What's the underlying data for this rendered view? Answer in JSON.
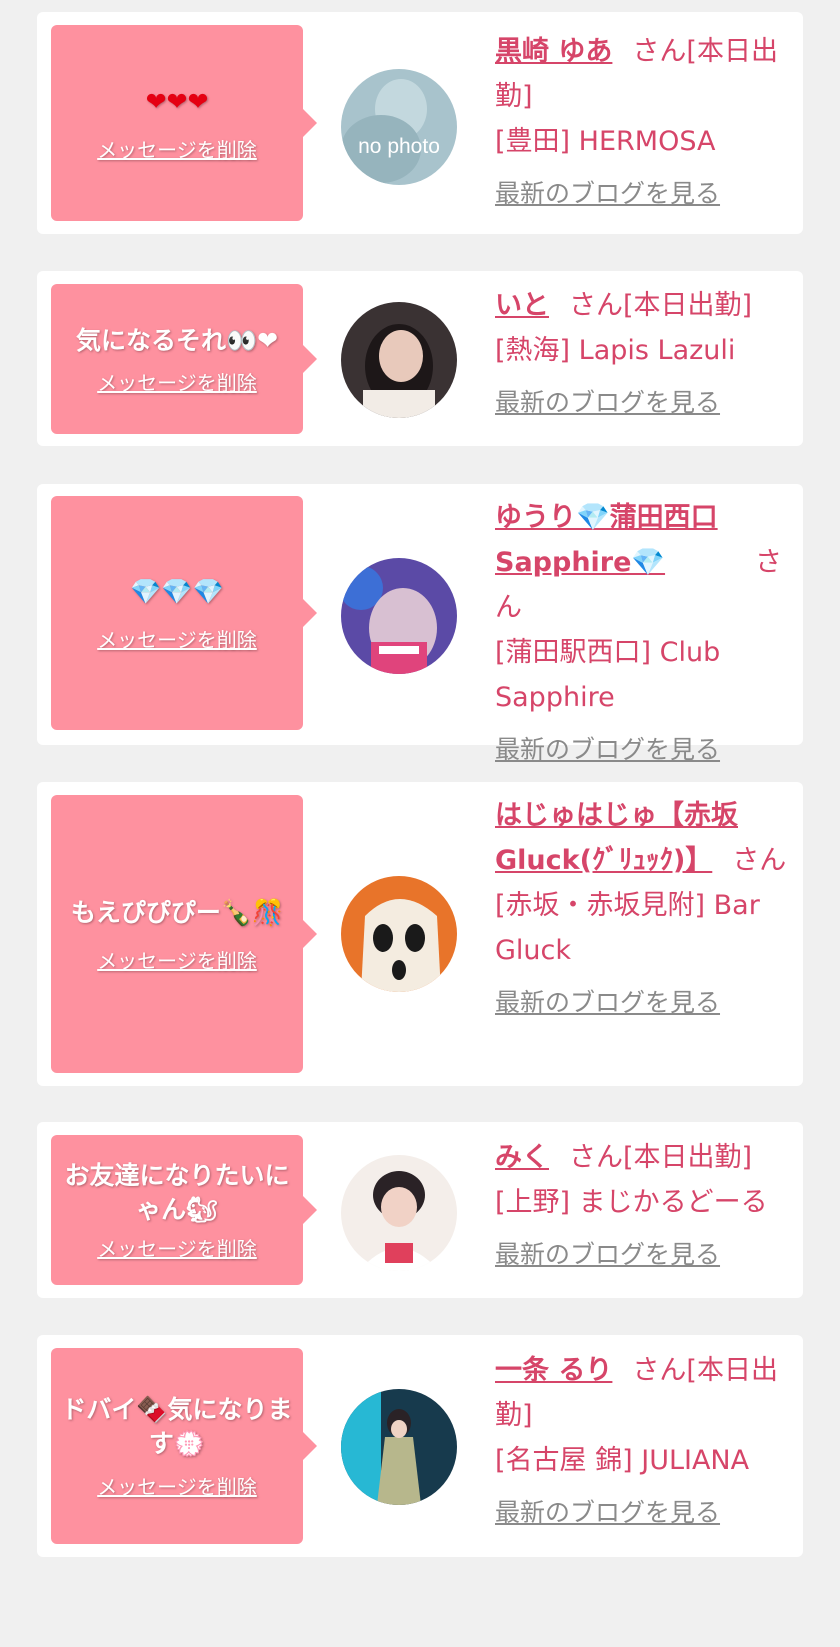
{
  "messages": [
    {
      "message": "❤❤❤",
      "delete_label": "メッセージを削除",
      "name": "黒崎 ゆあ",
      "san": "さん",
      "status": "[本日出勤]",
      "shop": "[豊田] HERMOSA",
      "blog_label": "最新のブログを見る",
      "avatar_text": "no photo"
    },
    {
      "message": "気になるそれ👀❤",
      "delete_label": "メッセージを削除",
      "name": "いと",
      "san": "さん",
      "status": "[本日出勤]",
      "shop": "[熱海] Lapis Lazuli",
      "blog_label": "最新のブログを見る"
    },
    {
      "message": "💎💎💎",
      "delete_label": "メッセージを削除",
      "name": "ゆうり💎蒲田西口Sapphire💎",
      "san": "さん",
      "status": "",
      "shop": "[蒲田駅西口] Club Sapphire",
      "blog_label": "最新のブログを見る"
    },
    {
      "message": "もえぴぴぴー🍾🎊",
      "delete_label": "メッセージを削除",
      "name": "はじゅはじゅ【赤坂Gluck(ｸﾞﾘｭｯｸ)】",
      "san": "さん",
      "status": "",
      "shop": "[赤坂・赤坂見附] Bar Gluck",
      "blog_label": "最新のブログを見る"
    },
    {
      "message": "お友達になりたいにゃん🐿",
      "delete_label": "メッセージを削除",
      "name": "みく",
      "san": "さん",
      "status": "[本日出勤]",
      "shop": "[上野] まじかるどーる",
      "blog_label": "最新のブログを見る"
    },
    {
      "message": "ドバイ🍫気になります💮",
      "delete_label": "メッセージを削除",
      "name": "一条 るり",
      "san": "さん",
      "status": "[本日出勤]",
      "shop": "[名古屋 錦] JULIANA",
      "blog_label": "最新のブログを見る"
    }
  ],
  "colors": {
    "page_bg": "#f0f0f0",
    "card_bg": "#ffffff",
    "bubble": "#fe919f",
    "name": "#d64569",
    "blog_link": "#8a8a8a"
  }
}
